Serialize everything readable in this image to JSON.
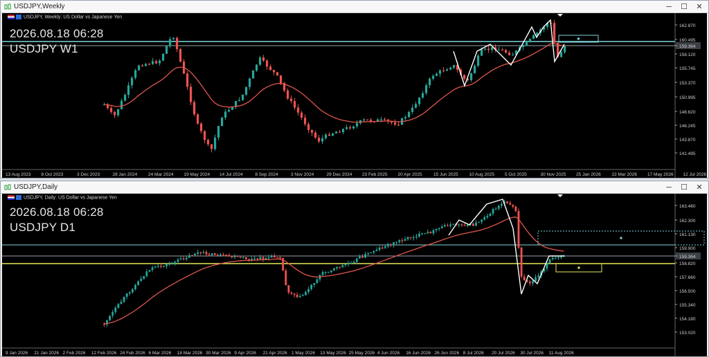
{
  "windows": [
    {
      "title": "USDJPY,Weekly",
      "info_line": "USDJPY, Weekly:  US Dollar vs Japanese Yen",
      "overlay_date": "2026.08.18 06:28",
      "overlay_symbol": "USDJPY W1",
      "price_labels": [
        "162.870",
        "160.495",
        "159.364",
        "158.120",
        "155.745",
        "153.370",
        "150.995",
        "148.620",
        "146.245",
        "143.870",
        "141.495"
      ],
      "current_price_label": "159.364",
      "date_labels": [
        "13 Aug 2023",
        "8 Oct 2023",
        "3 Dec 2023",
        "28 Jan 2024",
        "24 Mar 2024",
        "19 May 2024",
        "14 Jul 2024",
        "8 Sep 2024",
        "3 Nov 2024",
        "29 Dec 2024",
        "23 Feb 2025",
        "20 Apr 2025",
        "15 Jun 2025",
        "10 Aug 2025",
        "5 Oct 2025",
        "30 Nov 2025",
        "25 Jan 2026",
        "22 Mar 2026",
        "17 May 2026",
        "12 Jul 2026"
      ],
      "colors": {
        "bull": "#26a69a",
        "bear": "#ef5350",
        "ma": "#e0574d",
        "hline": "#7fd6dc"
      }
    },
    {
      "title": "USDJPY,Daily",
      "info_line": "USDJPY, Daily:  US Dollar vs Japanese Yen",
      "overlay_date": "2026.08.18 06:28",
      "overlay_symbol": "USDJPY D1",
      "price_labels": [
        "163.460",
        "162.300",
        "161.130",
        "159.900",
        "159.364",
        "158.820",
        "157.660",
        "156.500",
        "155.340",
        "154.180",
        "153.020"
      ],
      "current_price_label": "159.364",
      "date_labels": [
        "9 Jan 2026",
        "21 Jan 2026",
        "2 Feb 2026",
        "12 Feb 2026",
        "24 Feb 2026",
        "6 Mar 2026",
        "18 Mar 2026",
        "30 Mar 2026",
        "9 Apr 2026",
        "21 Apr 2026",
        "1 May 2026",
        "13 May 2026",
        "25 May 2026",
        "4 Jun 2026",
        "16 Jun 2026",
        "26 Jun 2026",
        "8 Jul 2026",
        "20 Jul 2026",
        "30 Jul 2026",
        "11 Aug 2026"
      ],
      "colors": {
        "bull": "#26a69a",
        "bear": "#ef5350",
        "ma": "#e0574d",
        "hline": "#7fd6dc",
        "yline": "#e8e85a"
      }
    }
  ],
  "buttons": {
    "minimize": "─",
    "maximize": "☐",
    "close": "✕"
  }
}
